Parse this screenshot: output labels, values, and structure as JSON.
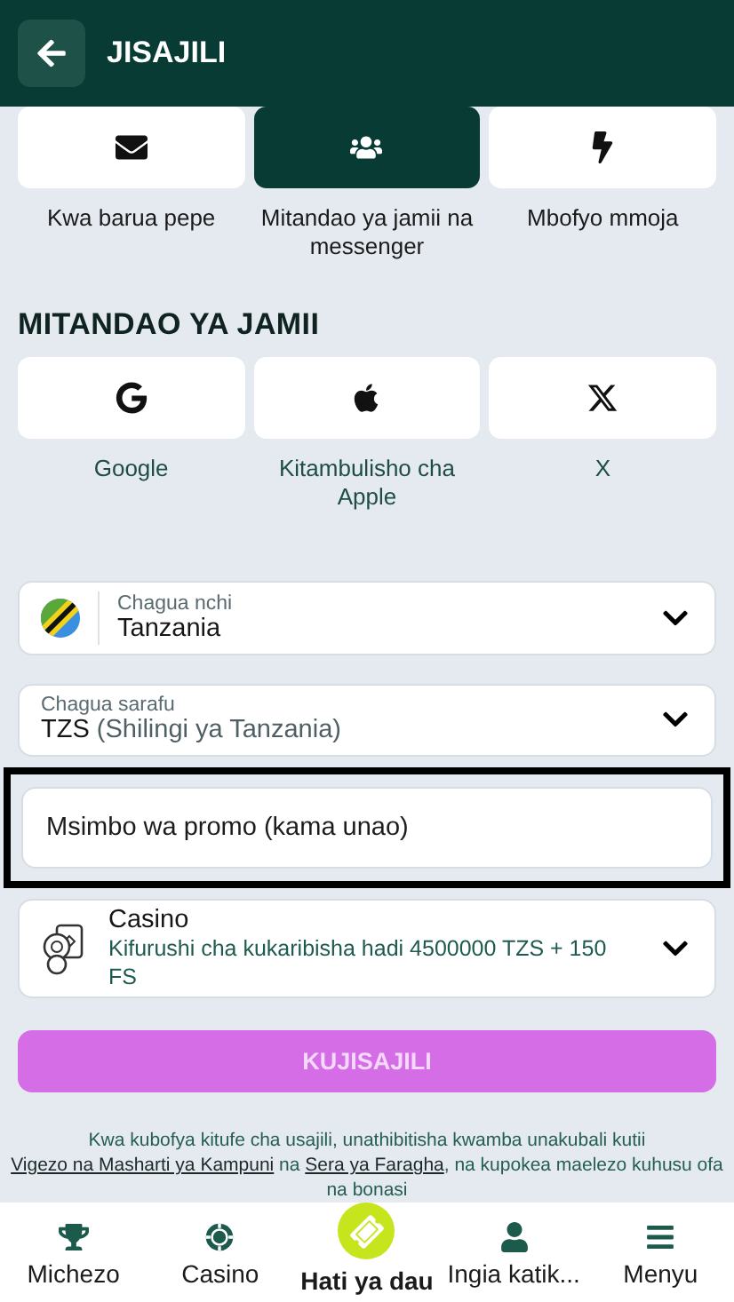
{
  "header": {
    "title": "JISAJILI"
  },
  "methods": [
    {
      "kind": "email",
      "label": "Kwa barua pepe",
      "selected": false
    },
    {
      "kind": "social",
      "label": "Mitandao ya jamii na messenger",
      "selected": true
    },
    {
      "kind": "oneclick",
      "label": "Mbofyo mmoja",
      "selected": false
    }
  ],
  "social_title": "MITANDAO YA JAMII",
  "social": [
    {
      "kind": "google",
      "label": "Google"
    },
    {
      "kind": "apple",
      "label": "Kitambulisho cha Apple"
    },
    {
      "kind": "x",
      "label": "X"
    }
  ],
  "country": {
    "label": "Chagua nchi",
    "value": "Tanzania"
  },
  "currency": {
    "label": "Chagua sarafu",
    "code": "TZS",
    "name": "(Shilingi ya Tanzania)"
  },
  "promo": {
    "placeholder": "Msimbo wa promo (kama unao)",
    "highlighted": true
  },
  "bonus": {
    "title": "Casino",
    "description": "Kifurushi cha kukaribisha hadi 4500000 TZS + 150 FS"
  },
  "submit": {
    "label": "KUJISAJILI",
    "disabled": true
  },
  "legal": [
    {
      "kind": "text",
      "text": "Kwa kubofya kitufe cha usajili, unathibitisha kwamba unakubali kutii "
    },
    {
      "kind": "link",
      "text": "Vigezo na Masharti ya Kampuni"
    },
    {
      "kind": "text",
      "text": " na "
    },
    {
      "kind": "link",
      "text": "Sera ya Faragha"
    },
    {
      "kind": "text",
      "text": ", na kupokea maelezo kuhusu ofa na bonasi"
    }
  ],
  "nav": [
    {
      "kind": "sports",
      "label": "Michezo",
      "selected": false
    },
    {
      "kind": "casino",
      "label": "Casino",
      "selected": false
    },
    {
      "kind": "betslip",
      "label": "Hati ya dau",
      "selected": true
    },
    {
      "kind": "login",
      "label": "Ingia katik...",
      "selected": false
    },
    {
      "kind": "menu",
      "label": "Menyu",
      "selected": false
    }
  ]
}
